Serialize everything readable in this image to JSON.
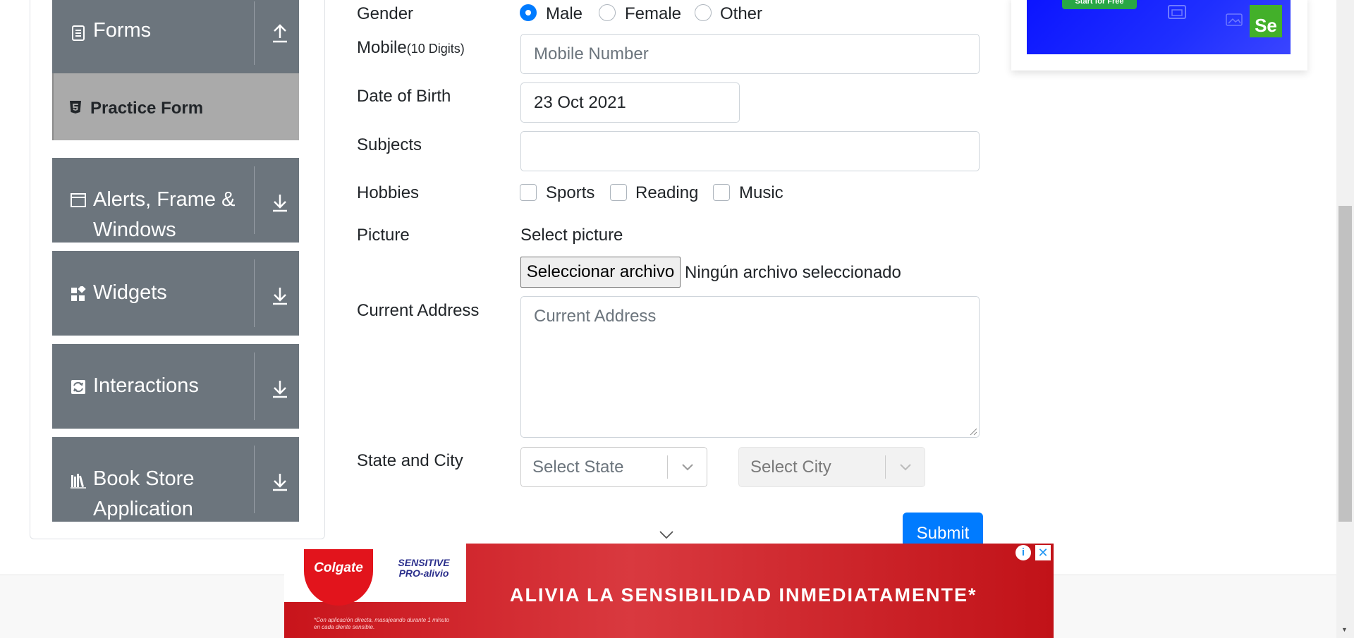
{
  "sidebar": {
    "groups": [
      {
        "label": "Forms",
        "icon": "document-icon",
        "arrow": "upload-arrow-icon"
      },
      {
        "label": "Alerts, Frame &",
        "label2": "Windows",
        "icon": "window-icon",
        "arrow": "download-arrow-icon"
      },
      {
        "label": "Widgets",
        "icon": "widgets-icon",
        "arrow": "download-arrow-icon"
      },
      {
        "label": "Interactions",
        "icon": "interactions-icon",
        "arrow": "download-arrow-icon"
      },
      {
        "label": "Book Store",
        "label2": "Application",
        "icon": "books-icon",
        "arrow": "download-arrow-icon"
      }
    ],
    "active_item": {
      "label": "Practice Form",
      "icon": "html5-icon"
    }
  },
  "form": {
    "gender": {
      "label": "Gender",
      "options": [
        "Male",
        "Female",
        "Other"
      ],
      "selected": "Male"
    },
    "mobile": {
      "label": "Mobile",
      "hint": "(10 Digits)",
      "placeholder": "Mobile Number"
    },
    "dob": {
      "label": "Date of Birth",
      "value": "23 Oct 2021"
    },
    "subjects": {
      "label": "Subjects",
      "value": ""
    },
    "hobbies": {
      "label": "Hobbies",
      "options": [
        "Sports",
        "Reading",
        "Music"
      ]
    },
    "picture": {
      "label": "Picture",
      "prompt": "Select picture",
      "button": "Seleccionar archivo",
      "status": "Ningún archivo seleccionado"
    },
    "address": {
      "label": "Current Address",
      "placeholder": "Current Address"
    },
    "state_city": {
      "label": "State and City",
      "state_placeholder": "Select State",
      "city_placeholder": "Select City"
    },
    "submit": "Submit"
  },
  "top_ad": {
    "cta": "Start for Free",
    "logo": "Se"
  },
  "bottom_ad": {
    "brand": "Colgate",
    "product_line1": "SENSITIVE",
    "product_line2": "PRO-alivio",
    "headline": "ALIVIA LA SENSIBILIDAD INMEDIATAMENTE*",
    "fine_print": "*Con aplicación directa, masajeando durante 1 minuto en cada diente sensible.",
    "info": "i",
    "close": "✕"
  },
  "colors": {
    "accent": "#007bff",
    "sidebar_group": "#6c757d",
    "active_item": "#aaaaaa",
    "ad_red": "#c8141b"
  }
}
